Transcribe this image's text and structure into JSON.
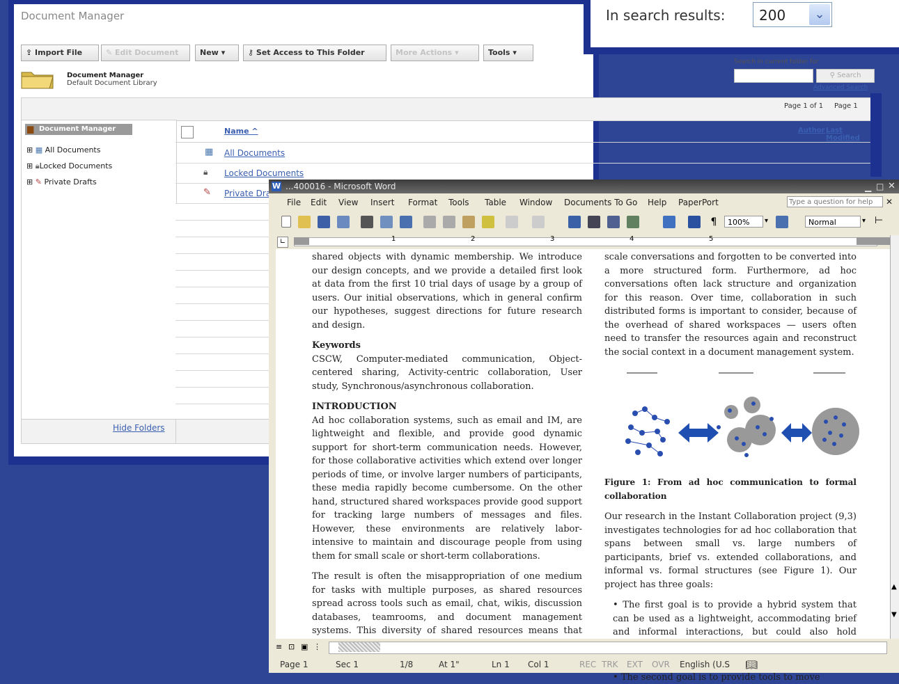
{
  "doc_manager": {
    "title": "Document Manager",
    "toolbar": {
      "import_file": "Import File",
      "edit_document": "Edit Document",
      "new": "New",
      "set_access": "Set Access to This Folder",
      "more_actions": "More Actions",
      "tools": "Tools"
    },
    "library": {
      "name": "Document Manager",
      "subtitle": "Default Document Library"
    },
    "search": {
      "label": "Search in current folder for",
      "button": "Search",
      "advanced": "Advanced Search"
    },
    "paging": {
      "page_of": "Page 1 of 1",
      "page": "Page 1"
    },
    "tree": {
      "root": "Document Manager",
      "items": [
        "All Documents",
        "Locked Documents",
        "Private Drafts"
      ]
    },
    "columns": {
      "name": "Name",
      "author": "Author",
      "last_modified": "Last Modified"
    },
    "rows": [
      "All Documents",
      "Locked Documents",
      "Private Drafts"
    ],
    "hide_folders": "Hide Folders"
  },
  "search_results": {
    "label": "In search results:",
    "value": "200"
  },
  "word": {
    "title": "...400016 - Microsoft Word",
    "menu": [
      "File",
      "Edit",
      "View",
      "Insert",
      "Format",
      "Tools",
      "Table",
      "Window",
      "Documents To Go",
      "Help",
      "PaperPort"
    ],
    "help_box": "Type a question for help",
    "zoom": "100%",
    "style": "Normal",
    "left_col": {
      "intro_para": "shared objects with dynamic membership. We introduce our design concepts, and we provide a detailed first look at data from the first 10 trial days of usage by a group of users. Our initial observations, which in general confirm our hypotheses, suggest directions for future research and design.",
      "keywords_head": "Keywords",
      "keywords": "CSCW, Computer-mediated communication, Object-centered sharing, Activity-centric collaboration, User study, Synchronous/asynchronous collaboration.",
      "intro_head": "INTRODUCTION",
      "p1": "Ad hoc collaboration systems, such as email and IM, are lightweight and flexible, and provide good dynamic support for short-term communication needs. However, for those collaborative activities which extend over longer periods of time, or involve larger numbers of participants, these media rapidly become cumbersome. On the other hand, structured shared workspaces provide good support for tracking large numbers of messages and files. However, these environments are relatively labor-intensive to maintain and discourage people from using them for small scale or short-term collaborations.",
      "p2": "The result is often the misappropriation of one medium for tasks with multiple purposes, as shared resources spread across tools such as email, chat, wikis, discussion databases, teamrooms, and document management systems. This diversity of shared resources means that people must monitor and participate in numerous shared venues."
    },
    "right_col": {
      "top_para": "scale conversations and forgotten to be converted into a more structured form. Furthermore, ad hoc conversations often lack structure and organization for this reason. Over time, collaboration in such distributed forms is important to consider, because of the overhead of shared workspaces — users often need to transfer the resources again and reconstruct the social context in a document management system.",
      "figure_caption": "Figure 1: From ad hoc communication to formal collaboration",
      "p1": "Our research in the Instant Collaboration project (9,3) investigates technologies for ad hoc collaboration that spans between small vs. large numbers of participants, brief vs. extended collaborations, and informal vs. formal structures (see Figure 1). Our project has three goals:",
      "bullet1": "The first goal is to provide a hybrid system that can be used as a lightweight, accommodating brief and informal interactions, but could also hold longer-term resources that people could share over time.",
      "bullet2": "The second goal is to provide tools to move"
    },
    "status": {
      "page": "Page 1",
      "sec": "Sec 1",
      "pos": "1/8",
      "at": "At 1\"",
      "ln": "Ln 1",
      "col": "Col 1",
      "rec": "REC",
      "trk": "TRK",
      "ext": "EXT",
      "ovr": "OVR",
      "lang": "English (U.S"
    }
  }
}
